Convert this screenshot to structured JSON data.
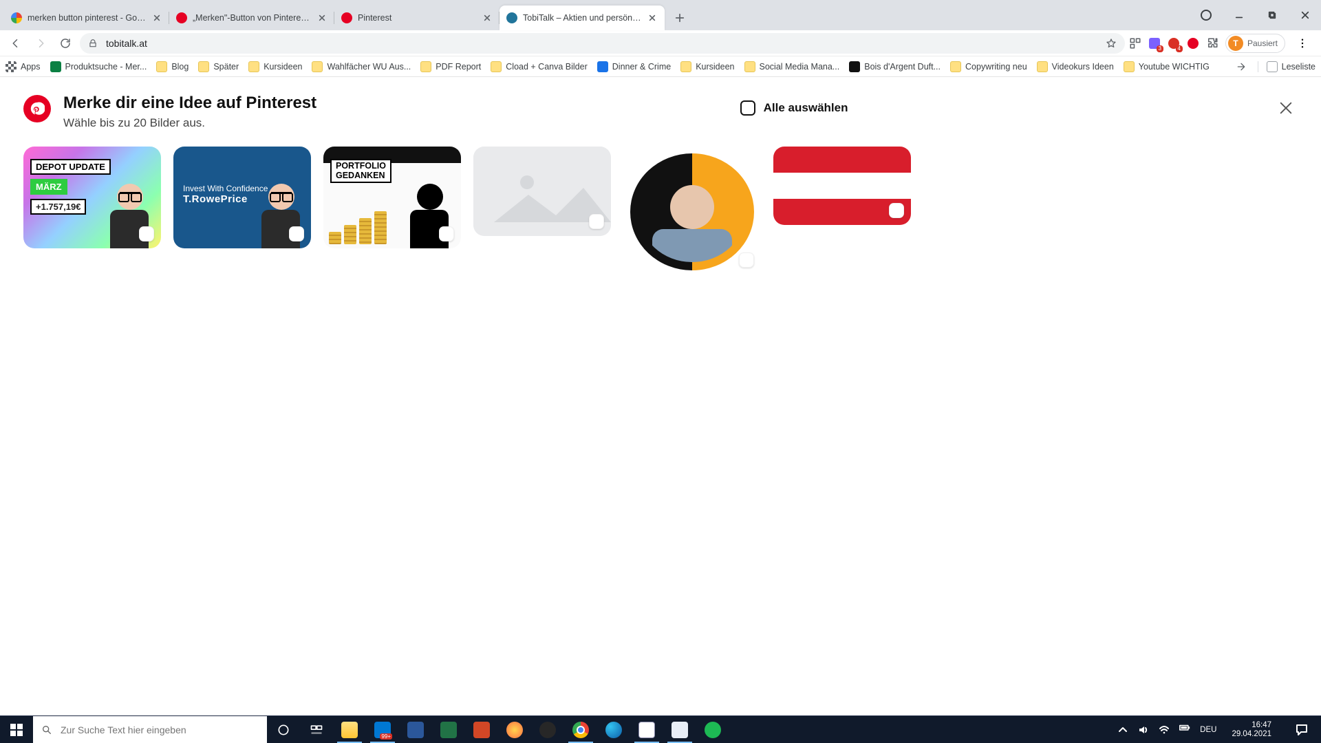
{
  "browser": {
    "tabs": [
      {
        "title": "merken button pinterest - Googl",
        "favicon": "google"
      },
      {
        "title": "„Merken\"-Button von Pinterest -",
        "favicon": "pinterest"
      },
      {
        "title": "Pinterest",
        "favicon": "pinterest"
      },
      {
        "title": "TobiTalk – Aktien und persönlich",
        "favicon": "wordpress",
        "active": true
      }
    ],
    "address": "tobitalk.at",
    "profile": {
      "label": "Pausiert",
      "initial": "T"
    },
    "bookmarks": [
      {
        "label": "Apps",
        "type": "apps"
      },
      {
        "label": "Produktsuche - Mer...",
        "type": "site",
        "color": "#0b8043"
      },
      {
        "label": "Blog",
        "type": "folder"
      },
      {
        "label": "Später",
        "type": "folder"
      },
      {
        "label": "Kursideen",
        "type": "folder"
      },
      {
        "label": "Wahlfächer WU Aus...",
        "type": "folder"
      },
      {
        "label": "PDF Report",
        "type": "folder"
      },
      {
        "label": "Cload + Canva Bilder",
        "type": "folder"
      },
      {
        "label": "Dinner & Crime",
        "type": "site",
        "color": "#1a73e8"
      },
      {
        "label": "Kursideen",
        "type": "folder"
      },
      {
        "label": "Social Media Mana...",
        "type": "folder"
      },
      {
        "label": "Bois d'Argent Duft...",
        "type": "site",
        "color": "#111"
      },
      {
        "label": "Copywriting neu",
        "type": "folder"
      },
      {
        "label": "Videokurs Ideen",
        "type": "folder"
      },
      {
        "label": "Youtube WICHTIG",
        "type": "folder"
      }
    ],
    "reading_list": "Leseliste"
  },
  "pinterest": {
    "title": "Merke dir eine Idee auf Pinterest",
    "subtitle": "Wähle bis zu 20 Bilder aus.",
    "select_all": "Alle auswählen",
    "images": [
      {
        "id": "depot-update",
        "caption_lines": [
          "DEPOT UPDATE",
          "MÄRZ",
          "+1.757,19€"
        ]
      },
      {
        "id": "trowe",
        "brand_small": "Invest With Confidence",
        "brand": "T.RowePrice"
      },
      {
        "id": "portfolio",
        "caption_lines": [
          "PORTFOLIO",
          "GEDANKEN"
        ]
      },
      {
        "id": "placeholder"
      },
      {
        "id": "avatar"
      },
      {
        "id": "flag-austria"
      }
    ]
  },
  "taskbar": {
    "search_placeholder": "Zur Suche Text hier eingeben",
    "lang": "DEU",
    "time": "16:47",
    "date": "29.04.2021",
    "apps": [
      {
        "name": "cortana",
        "color": "#fff"
      },
      {
        "name": "task-view"
      },
      {
        "name": "explorer",
        "running": true
      },
      {
        "name": "mail",
        "badge": "99+",
        "running": true
      },
      {
        "name": "word"
      },
      {
        "name": "excel"
      },
      {
        "name": "powerpoint"
      },
      {
        "name": "emoji"
      },
      {
        "name": "obs"
      },
      {
        "name": "chrome",
        "running": true
      },
      {
        "name": "edge"
      },
      {
        "name": "notepad",
        "running": true
      },
      {
        "name": "doc",
        "running": true
      },
      {
        "name": "spotify"
      }
    ]
  }
}
